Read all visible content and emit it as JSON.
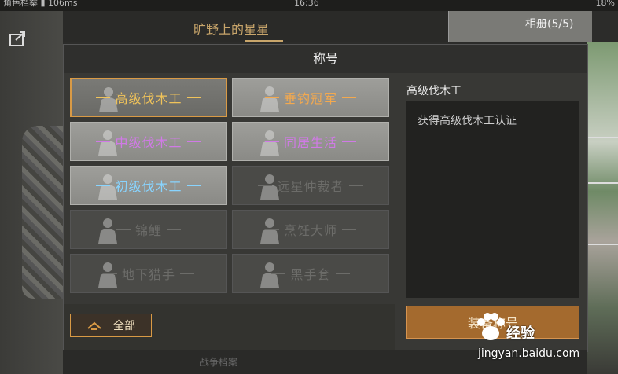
{
  "statusbar": {
    "left": "角色档案 ▮ 106ms",
    "time": "16:36",
    "battery": "18%"
  },
  "header": {
    "character_name": "旷野上的星星",
    "album_tab": "相册(5/5)"
  },
  "modal": {
    "title": "称号",
    "titles": [
      {
        "label": "高级伐木工",
        "state": "selected",
        "color": "gold"
      },
      {
        "label": "垂钓冠军",
        "state": "unlocked",
        "color": "orange"
      },
      {
        "label": "中级伐木工",
        "state": "unlocked",
        "color": "purple"
      },
      {
        "label": "同居生活",
        "state": "unlocked",
        "color": "purple"
      },
      {
        "label": "初级伐木工",
        "state": "unlocked",
        "color": "blue"
      },
      {
        "label": "远星仲裁者",
        "state": "locked",
        "color": "gray"
      },
      {
        "label": "锦鲤",
        "state": "locked",
        "color": "gray"
      },
      {
        "label": "烹饪大师",
        "state": "locked",
        "color": "gray"
      },
      {
        "label": "地下猎手",
        "state": "locked",
        "color": "gray"
      },
      {
        "label": "黑手套",
        "state": "locked",
        "color": "gray"
      }
    ],
    "filter_label": "全部",
    "detail_title": "高级伐木工",
    "detail_desc": "获得高级伐木工认证",
    "equip_label": "装备称号"
  },
  "bottom_text": "战争档案",
  "watermark": {
    "brand": "经验",
    "url": "jingyan.baidu.com"
  },
  "colors": {
    "accent": "#d99a45",
    "gold": "#f0c35a",
    "purple": "#d07ae6",
    "blue": "#88d4ff"
  }
}
